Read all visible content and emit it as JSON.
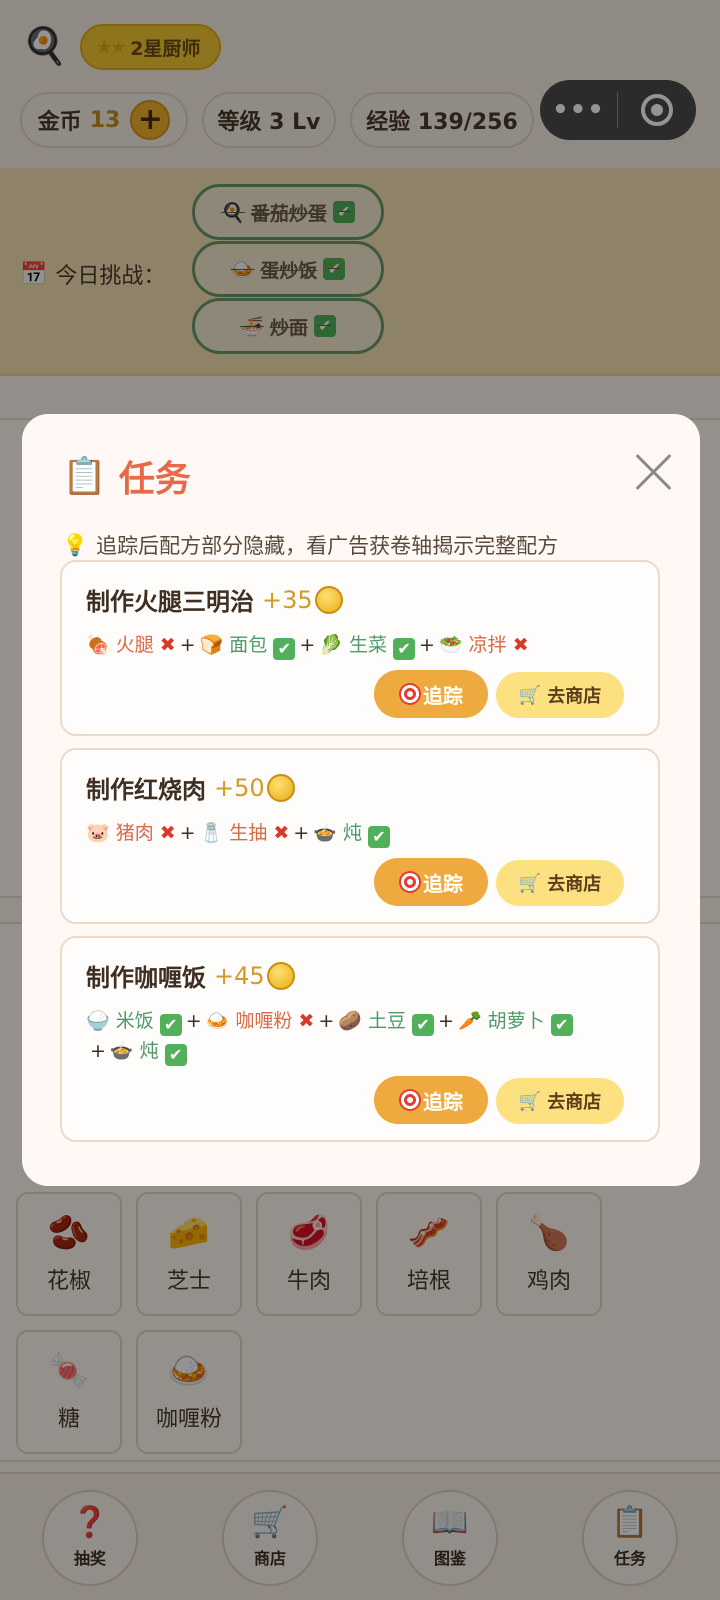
{
  "header": {
    "chef_badge": "2星厨师",
    "stats": {
      "coins_label": "金币",
      "coins_value": "13",
      "level": "等级 3 Lv",
      "exp": "经验 139/256"
    },
    "capsule": {
      "more": "•••"
    }
  },
  "challenge": {
    "label": "今日挑战：",
    "items": [
      {
        "name": "番茄炒蛋",
        "icon": "🍳"
      },
      {
        "name": "蛋炒饭",
        "icon": "🍛"
      },
      {
        "name": "炒面",
        "icon": "🍜"
      }
    ]
  },
  "ingredients_grid": [
    {
      "name": "花椒",
      "icon": "🫘"
    },
    {
      "name": "芝士",
      "icon": "🧀"
    },
    {
      "name": "牛肉",
      "icon": "🥩"
    },
    {
      "name": "培根",
      "icon": "🥓"
    },
    {
      "name": "鸡肉",
      "icon": "🍗"
    },
    {
      "name": "糖",
      "icon": "🍬"
    },
    {
      "name": "咖喱粉",
      "icon": "🍛"
    }
  ],
  "bottom_nav": [
    {
      "label": "抽奖",
      "icon": "❓"
    },
    {
      "label": "商店",
      "icon": "🛒"
    },
    {
      "label": "图鉴",
      "icon": "📖"
    },
    {
      "label": "任务",
      "icon": "📋"
    }
  ],
  "modal": {
    "title": "任务",
    "title_icon": "📋",
    "hint_icon": "💡",
    "hint": "追踪后配方部分隐藏，看广告获卷轴揭示完整配方",
    "track_label": "追踪",
    "shop_label": "去商店",
    "tasks": [
      {
        "title": "制作火腿三明治",
        "reward": "+35",
        "ingredients": [
          {
            "icon": "🍖",
            "name": "火腿",
            "have": false
          },
          {
            "icon": "🍞",
            "name": "面包",
            "have": true
          },
          {
            "icon": "🥬",
            "name": "生菜",
            "have": true
          },
          {
            "icon": "🥗",
            "name": "凉拌",
            "have": false
          }
        ]
      },
      {
        "title": "制作红烧肉",
        "reward": "+50",
        "ingredients": [
          {
            "icon": "🐷",
            "name": "猪肉",
            "have": false
          },
          {
            "icon": "🧂",
            "name": "生抽",
            "have": false
          },
          {
            "icon": "🍲",
            "name": "炖",
            "have": true
          }
        ]
      },
      {
        "title": "制作咖喱饭",
        "reward": "+45",
        "ingredients": [
          {
            "icon": "🍚",
            "name": "米饭",
            "have": true
          },
          {
            "icon": "🍛",
            "name": "咖喱粉",
            "have": false
          },
          {
            "icon": "🥔",
            "name": "土豆",
            "have": true
          },
          {
            "icon": "🥕",
            "name": "胡萝卜",
            "have": true
          },
          {
            "icon": "🍲",
            "name": "炖",
            "have": true
          }
        ]
      }
    ]
  }
}
